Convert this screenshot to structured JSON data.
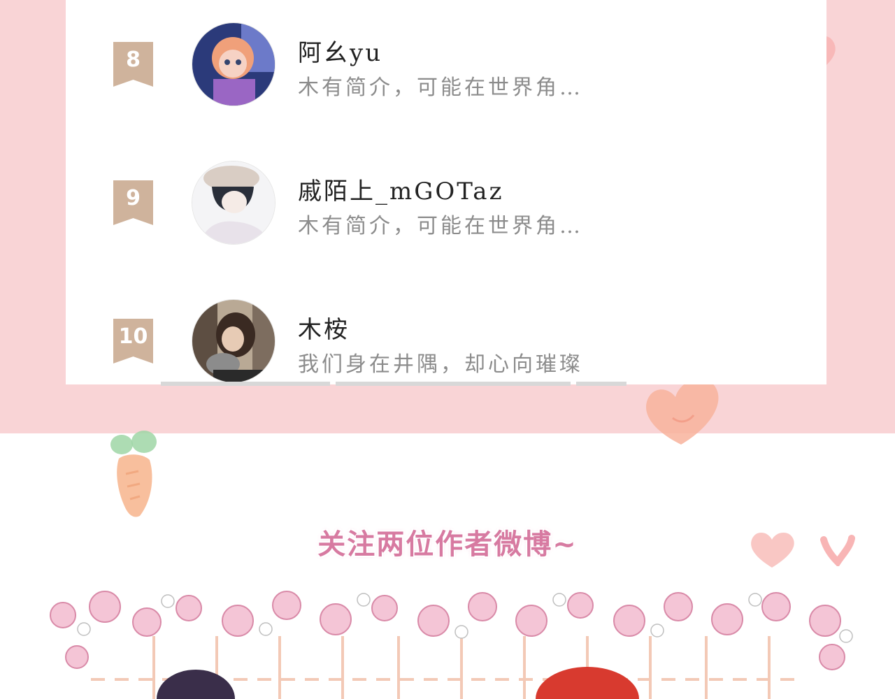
{
  "ranking": [
    {
      "rank": "8",
      "name": "阿幺yu",
      "bio": "木有简介，可能在世界角…"
    },
    {
      "rank": "9",
      "name": "戚陌上_mGOTaz",
      "bio": "木有简介，可能在世界角…"
    },
    {
      "rank": "10",
      "name": "木桉",
      "bio": "我们身在井隅，却心向璀璨"
    }
  ],
  "section_title": "关注两位作者微博~",
  "colors": {
    "background_pink": "#f9d4d6",
    "rank_badge": "#cfb39c",
    "title_pink": "#d77aa1",
    "bio_gray": "#8c8c8c"
  },
  "icons": [
    "ribbon-badge-icon",
    "heart-icon",
    "carrot-icon",
    "flower-garland"
  ]
}
